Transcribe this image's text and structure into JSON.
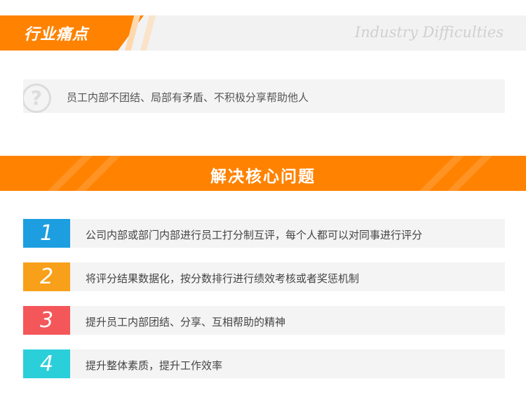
{
  "header": {
    "title": "行业痛点",
    "subtitle_en": "Industry Difficulties"
  },
  "pain": {
    "text": "员工内部不团结、局部有矛盾、不积极分享帮助他人",
    "icon": "question-icon"
  },
  "solve": {
    "title": "解决核心问题"
  },
  "items": [
    {
      "num": "1",
      "text": "公司内部或部门内部进行员工打分制互评，每个人都可以对同事进行评分",
      "color": "#1c9ee0"
    },
    {
      "num": "2",
      "text": "将评分结果数据化，按分数排行进行绩效考核或者奖惩机制",
      "color": "#f8a01a"
    },
    {
      "num": "3",
      "text": "提升员工内部团结、分享、互相帮助的精神",
      "color": "#f4575a"
    },
    {
      "num": "4",
      "text": "提升整体素质，提升工作效率",
      "color": "#2bcfd9"
    }
  ],
  "colors": {
    "accent": "#ff8200"
  }
}
